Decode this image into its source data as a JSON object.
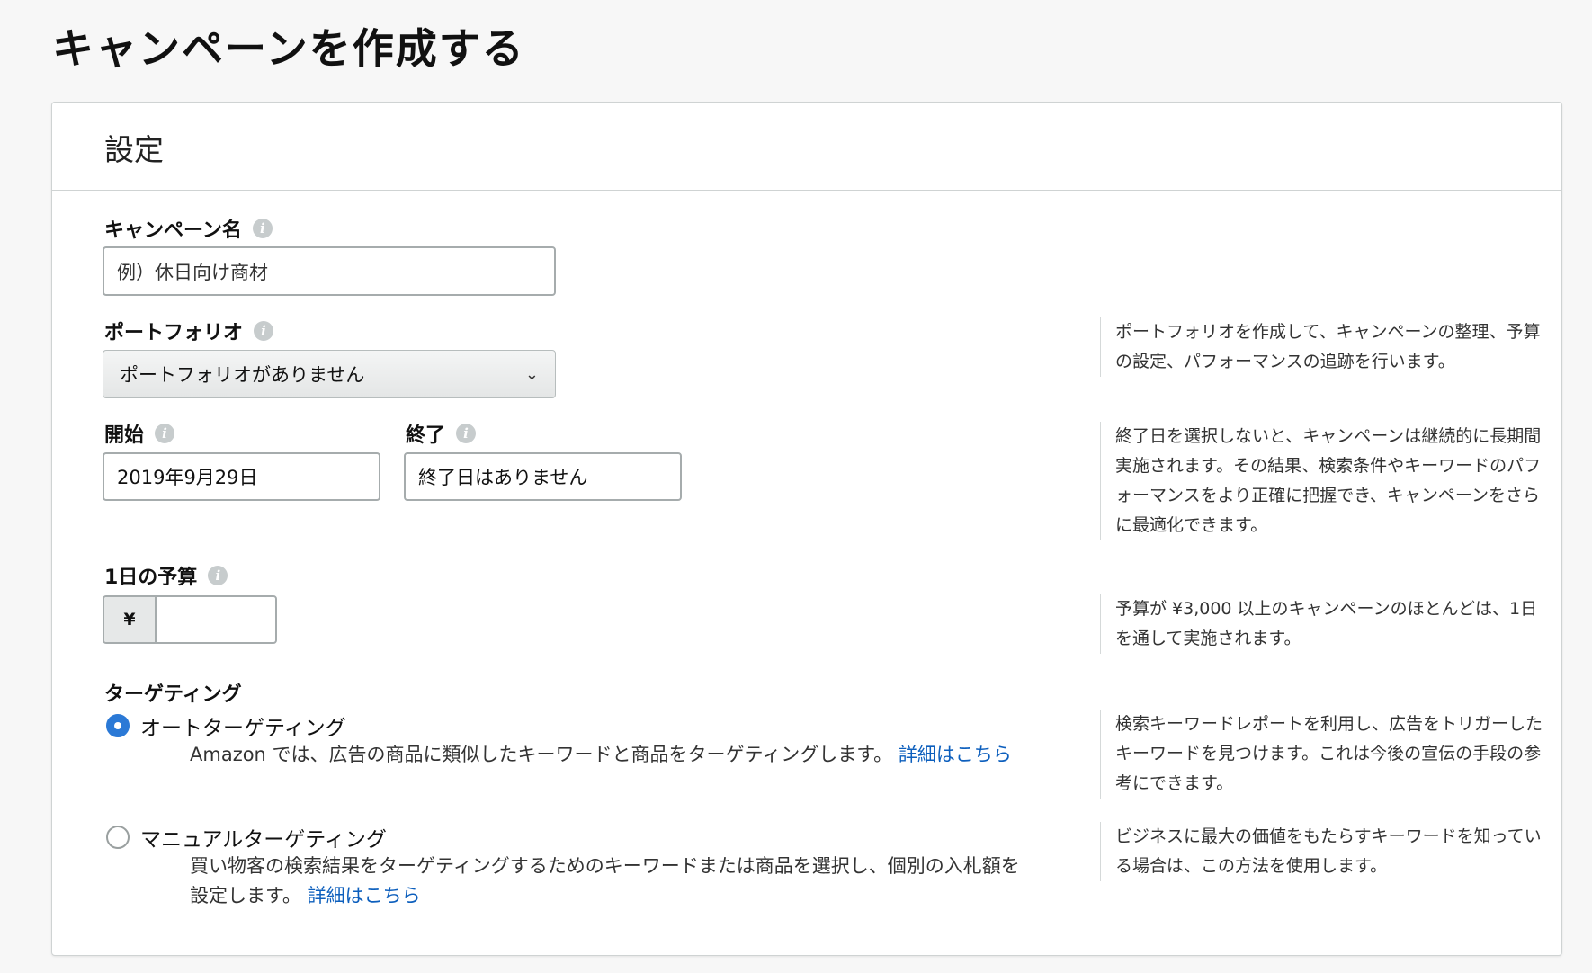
{
  "page": {
    "title": "キャンペーンを作成する"
  },
  "settings": {
    "title": "設定",
    "campaign_name": {
      "label": "キャンペーン名",
      "placeholder": "例）休日向け商材"
    },
    "portfolio": {
      "label": "ポートフォリオ",
      "selected": "ポートフォリオがありません",
      "help": "ポートフォリオを作成して、キャンペーンの整理、予算の設定、パフォーマンスの追跡を行います。"
    },
    "start": {
      "label": "開始",
      "value": "2019年9月29日"
    },
    "end": {
      "label": "終了",
      "value": "終了日はありません",
      "help": "終了日を選択しないと、キャンペーンは継続的に長期間実施されます。その結果、検索条件やキーワードのパフォーマンスをより正確に把握でき、キャンペーンをさらに最適化できます。"
    },
    "budget": {
      "label": "1日の予算",
      "currency": "¥",
      "value": "",
      "help": "予算が ¥3,000 以上のキャンペーンのほとんどは、1日を通して実施されます。"
    },
    "targeting": {
      "label": "ターゲティング",
      "auto": {
        "label": "オートターゲティング",
        "selected": true,
        "description": "Amazon では、広告の商品に類似したキーワードと商品をターゲティングします。",
        "link": "詳細はこちら",
        "help": "検索キーワードレポートを利用し、広告をトリガーしたキーワードを見つけます。これは今後の宣伝の手段の参考にできます。"
      },
      "manual": {
        "label": "マニュアルターゲティング",
        "selected": false,
        "description": "買い物客の検索結果をターゲティングするためのキーワードまたは商品を選択し、個別の入札額を設定します。",
        "link": "詳細はこちら",
        "help": "ビジネスに最大の価値をもたらすキーワードを知っている場合は、この方法を使用します。"
      }
    }
  },
  "icons": {
    "info": "info-icon",
    "chevron": "chevron-down-icon"
  },
  "colors": {
    "accent": "#2b79d6",
    "link": "#0d5fbd"
  }
}
